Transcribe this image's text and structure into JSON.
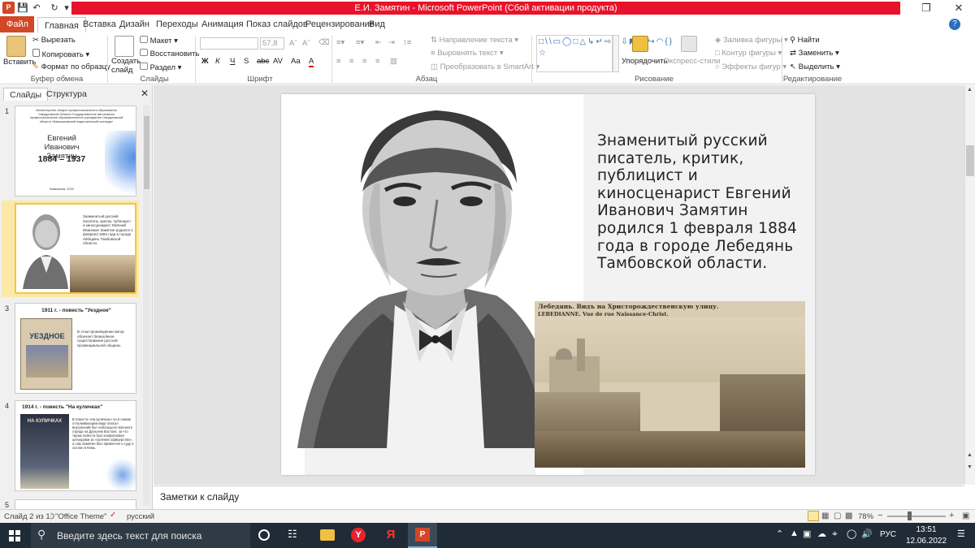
{
  "window": {
    "title": "Е.И. Замятин  -  Microsoft PowerPoint (Сбой активации продукта)"
  },
  "ribbon_tabs": [
    "Файл",
    "Главная",
    "Вставка",
    "Дизайн",
    "Переходы",
    "Анимация",
    "Показ слайдов",
    "Рецензирование",
    "Вид"
  ],
  "ribbon": {
    "clipboard": {
      "paste": "Вставить",
      "cut": "Вырезать",
      "copy": "Копировать",
      "format_painter": "Формат по образцу",
      "group": "Буфер обмена"
    },
    "slides": {
      "new_slide": "Создать слайд",
      "layout": "Макет",
      "reset": "Восстановить",
      "section": "Раздел",
      "group": "Слайды"
    },
    "font": {
      "size": "57,8",
      "group": "Шрифт"
    },
    "paragraph": {
      "text_direction": "Направление текста",
      "align_text": "Выровнять текст",
      "smartart": "Преобразовать в SmartArt",
      "group": "Абзац"
    },
    "drawing": {
      "arrange": "Упорядочить",
      "quick_styles": "Экспресс-стили",
      "shape_fill": "Заливка фигуры",
      "shape_outline": "Контур фигуры",
      "shape_effects": "Эффекты фигур",
      "group": "Рисование"
    },
    "editing": {
      "find": "Найти",
      "replace": "Заменить",
      "select": "Выделить",
      "group": "Редактирование"
    }
  },
  "panel": {
    "tab_slides": "Слайды",
    "tab_outline": "Структура"
  },
  "thumbnails": [
    {
      "num": "1",
      "header": "Министерство общего профессионального образования Свердловской области Государственное автономное профессиональное образовательное учреждение Свердловской области «Камышловский педагогический колледж»",
      "title": "Евгений Иванович Замятин",
      "years": "1884 – 1937",
      "footer": "Камышлов, 2022"
    },
    {
      "num": "2",
      "text": "Знаменитый русский писатель, критик, публицист и киносценарист Евгений Иванович Замятин родился 1 февраля 1884 года в городе Лебедянь Тамбовской области."
    },
    {
      "num": "3",
      "title": "1911 г. - повесть \"Уездное\"",
      "cover": "УЕЗДНОЕ",
      "text": "В этом произведении автор обличает безмолвное существование русской провинциальной общины."
    },
    {
      "num": "4",
      "title": "1914 г. - повесть \"На куличках\"",
      "cover": "НА КУЛИЧКАХ",
      "text": "В повести «На куличках» он в самом отталкивающем виде описал внутренний быт небольшого военного отряда на Дальнем Востоке, за что тираж повести был конфискован цензорами за «хуление офицерства», а сам Замятин был привлечен к суду и сослан в Кемь."
    },
    {
      "num": "5"
    }
  ],
  "slide": {
    "body": "Знаменитый русский писатель, критик, публицист и киносценарист Евгений Иванович Замятин родился 1 февраля 1884 года в городе Лебедянь Тамбовской области.",
    "photo_caption_line1": "Лебедянь.   Видъ на Христорождественскую улицу.",
    "photo_caption_line2": "LEBEDIANNE.   Vue de rue Naissance-Christ."
  },
  "notes_placeholder": "Заметки к слайду",
  "status": {
    "slide_counter": "Слайд 2 из 10",
    "theme": "\"Office Theme\"",
    "language": "русский",
    "zoom": "78%"
  },
  "taskbar": {
    "search_placeholder": "Введите здесь текст для поиска",
    "lang": "РУС",
    "time": "13:51",
    "date": "12.06.2022"
  },
  "colors": {
    "accent": "#d24726",
    "title_band": "#e8132a",
    "selection": "#f4c542",
    "taskbar": "#1f2b36"
  }
}
